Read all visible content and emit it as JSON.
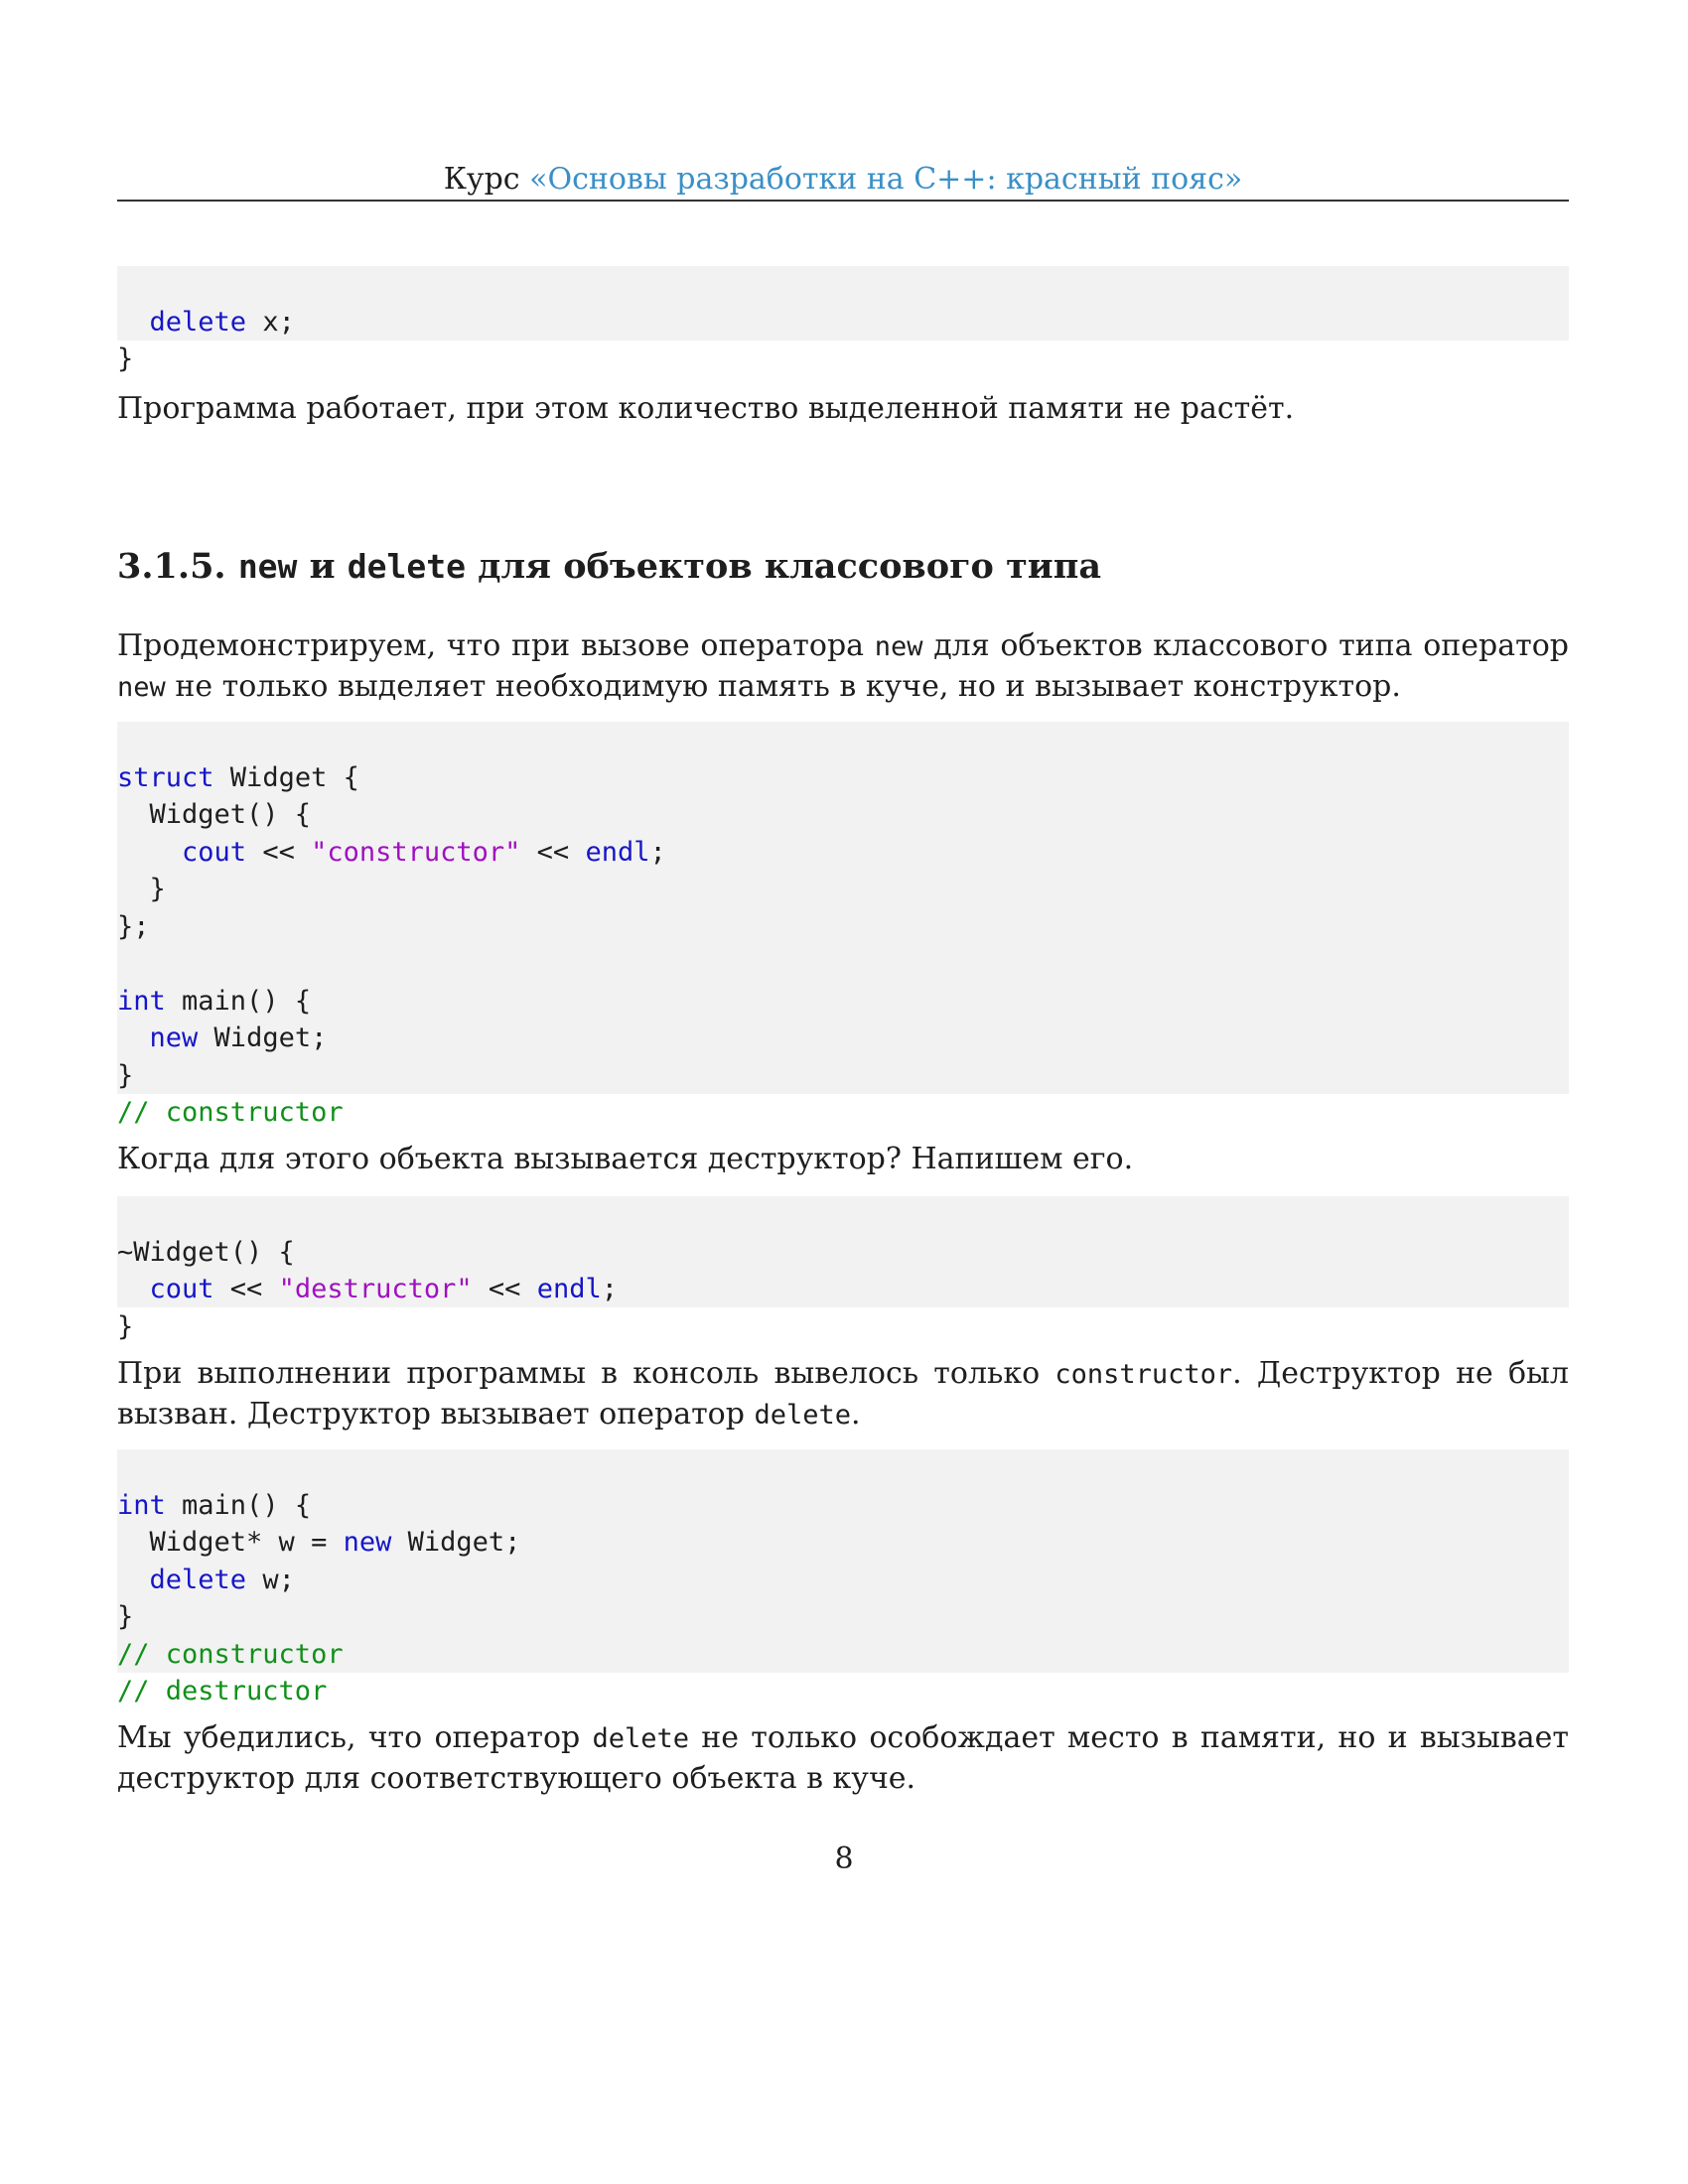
{
  "header": {
    "prefix": "Курс ",
    "course_title": "«Основы разработки на C++: красный пояс»"
  },
  "code_block_1": {
    "line1_kw": "delete",
    "line1_rest": " x;",
    "line2": "}"
  },
  "paragraph_1": "Программа работает, при этом количество выделенной памяти не растёт.",
  "section": {
    "number": "3.1.5.",
    "kw_new": "new",
    "and": " и ",
    "kw_delete": "delete",
    "title_rest": " для объектов классового типа"
  },
  "paragraph_2": {
    "part1": "Продемонстрируем, что при вызове оператора ",
    "code1": "new",
    "part2": " для объектов классового типа оператор ",
    "code2": "new",
    "part3": " не только выделяет необходимую память в куче, но и вызывает конструктор."
  },
  "code_block_2": {
    "l1_kw": "struct",
    "l1_rest": " Widget {",
    "l2": "  Widget() {",
    "l3_kw": "cout",
    "l3_op1": " << ",
    "l3_str": "\"constructor\"",
    "l3_op2": " << ",
    "l3_kw2": "endl",
    "l3_end": ";",
    "l4": "  }",
    "l5": "};",
    "l7_kw": "int",
    "l7_rest": " main() {",
    "l8_kw": "new",
    "l8_rest": " Widget;",
    "l9": "}",
    "l10_cm": "// constructor"
  },
  "paragraph_3": "Когда для этого объекта вызывается деструктор? Напишем его.",
  "code_block_3": {
    "l1": "~Widget() {",
    "l2_kw": "cout",
    "l2_op1": " << ",
    "l2_str": "\"destructor\"",
    "l2_op2": " << ",
    "l2_kw2": "endl",
    "l2_end": ";",
    "l3": "}"
  },
  "paragraph_4": {
    "part1": "При выполнении программы в консоль вывелось только ",
    "code1": "constructor",
    "part2": ". Деструктор не был вызван. Деструктор вызывает оператор ",
    "code2": "delete",
    "part3": "."
  },
  "code_block_4": {
    "l1_kw": "int",
    "l1_rest": " main() {",
    "l2_pre": "  Widget* w = ",
    "l2_kw": "new",
    "l2_rest": " Widget;",
    "l3_kw": "delete",
    "l3_rest": " w;",
    "l4": "}",
    "l5_cm": "// constructor",
    "l6_cm": "// destructor"
  },
  "paragraph_5": {
    "part1": "Мы убедились, что оператор ",
    "code1": "delete",
    "part2": " не только особождает место в памяти, но и вызывает деструктор для соответствующего объекта в куче."
  },
  "page_number": "8"
}
